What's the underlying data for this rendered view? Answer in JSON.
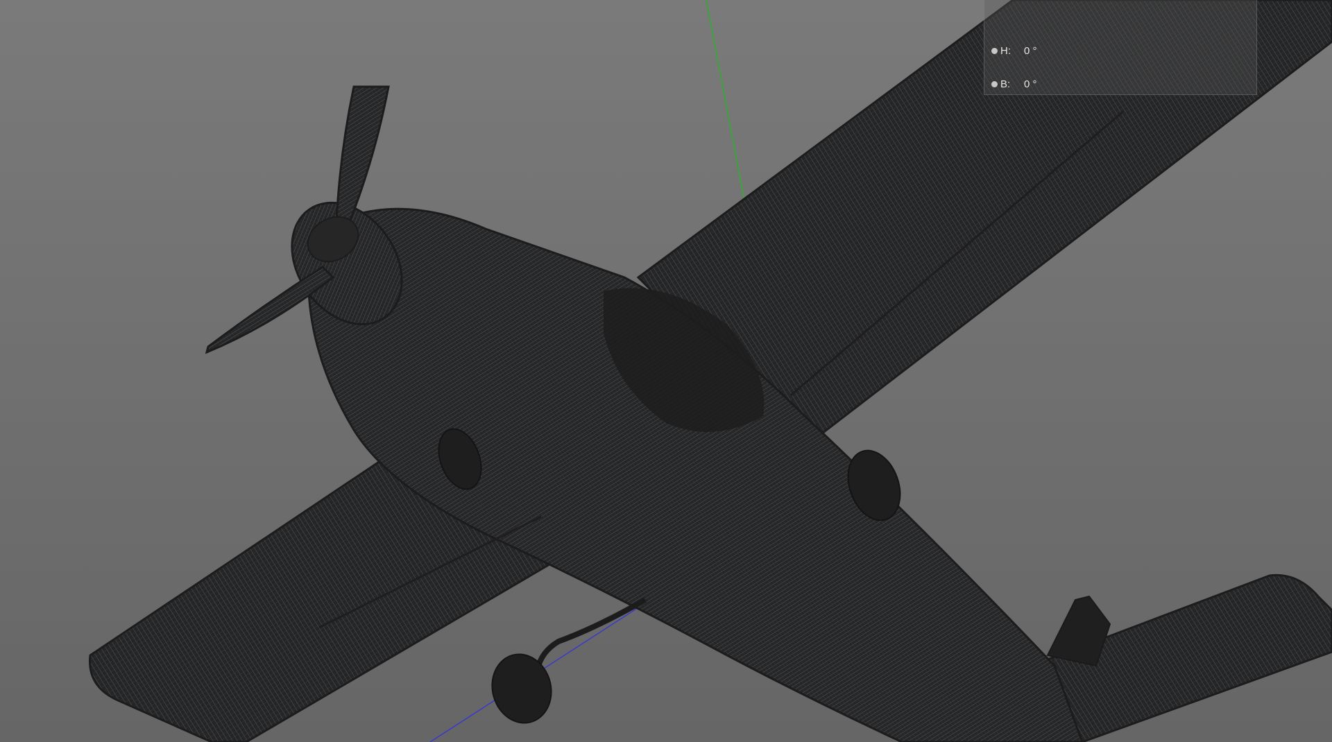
{
  "viewport": {
    "background_top": "#7a7a7a",
    "background_bottom": "#666666",
    "axis_colors": {
      "y_axis": "#3fa13f",
      "z_axis": "#3a3ac8"
    },
    "model_color": "#222222",
    "mesh_line_color": "#5b6470"
  },
  "coordinates_panel": {
    "rows": [
      {
        "label": "H:",
        "value": "0 °"
      },
      {
        "label": "B:",
        "value": "0 °"
      }
    ]
  }
}
